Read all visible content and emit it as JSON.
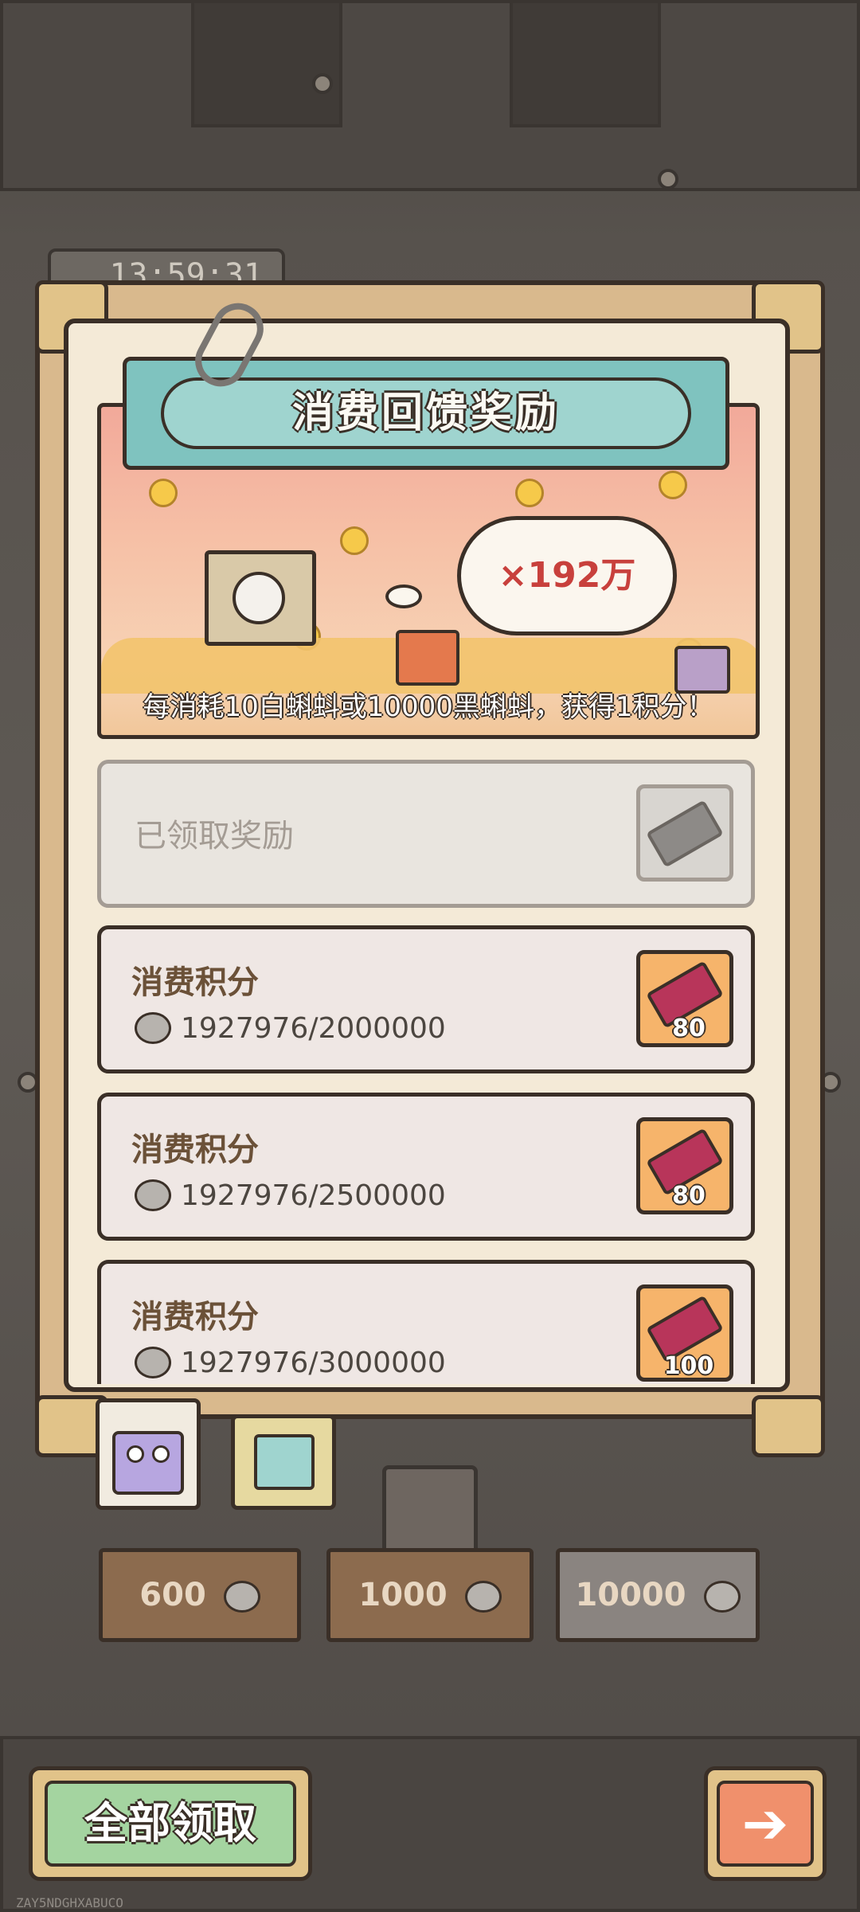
{
  "timer": "13:59:31",
  "title": "消费回馈奖励",
  "banner": {
    "multiplier": "×192万",
    "description": "每消耗10白蝌蚪或10000黑蝌蚪，获得1积分！"
  },
  "claimed_row": {
    "label": "已领取奖励"
  },
  "rewards": [
    {
      "title": "消费积分",
      "progress": "1927976/2000000",
      "count": "80"
    },
    {
      "title": "消费积分",
      "progress": "1927976/2500000",
      "count": "80"
    },
    {
      "title": "消费积分",
      "progress": "1927976/3000000",
      "count": "100"
    }
  ],
  "shop": {
    "prices": [
      "600",
      "1000",
      "10000"
    ]
  },
  "buttons": {
    "claim_all": "全部领取",
    "next_arrow": "➔"
  },
  "watermark": "ZAY5NDGHXABUCO",
  "colors": {
    "title_teal": "#7fc3bf",
    "ticket_orange": "#f6b46b",
    "ticket_red": "#b8355a",
    "claim_green": "#a4d4a0",
    "next_orange": "#f0906c"
  }
}
